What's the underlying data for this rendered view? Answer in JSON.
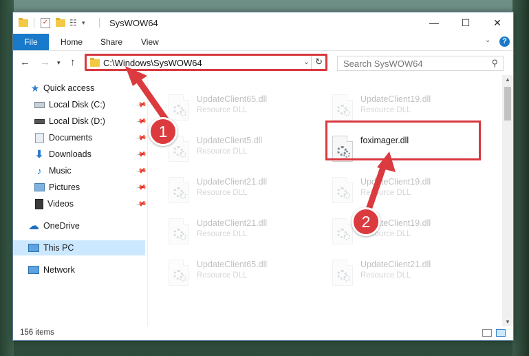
{
  "window": {
    "title": "SysWOW64",
    "controls": {
      "minimize": "—",
      "maximize": "☐",
      "close": "✕"
    }
  },
  "ribbon": {
    "file": "File",
    "tabs": [
      "Home",
      "Share",
      "View"
    ],
    "help": "?"
  },
  "address": {
    "path": "C:\\Windows\\SysWOW64"
  },
  "search": {
    "placeholder": "Search SysWOW64"
  },
  "sidebar": {
    "items": [
      {
        "label": "Quick access",
        "icon": "star-icon",
        "pinned": false
      },
      {
        "label": "Local Disk (C:)",
        "icon": "drive-icon",
        "pinned": true
      },
      {
        "label": "Local Disk (D:)",
        "icon": "drive-icon",
        "pinned": true
      },
      {
        "label": "Documents",
        "icon": "documents-icon",
        "pinned": true
      },
      {
        "label": "Downloads",
        "icon": "download-icon",
        "pinned": true
      },
      {
        "label": "Music",
        "icon": "music-icon",
        "pinned": true
      },
      {
        "label": "Pictures",
        "icon": "pictures-icon",
        "pinned": true
      },
      {
        "label": "Videos",
        "icon": "video-icon",
        "pinned": true
      },
      {
        "label": "OneDrive",
        "icon": "cloud-icon",
        "pinned": false
      },
      {
        "label": "This PC",
        "icon": "computer-icon",
        "pinned": false,
        "selected": true
      },
      {
        "label": "Network",
        "icon": "network-icon",
        "pinned": false
      }
    ]
  },
  "files": [
    {
      "name": "UpdateClient65.dll",
      "type": "Resource DLL",
      "faded": true
    },
    {
      "name": "UpdateClient19.dll",
      "type": "Resource DLL",
      "faded": true
    },
    {
      "name": "UpdateClient5.dll",
      "type": "Resource DLL",
      "faded": true
    },
    {
      "name": "foximager.dll",
      "type": "",
      "faded": false,
      "highlighted": true
    },
    {
      "name": "UpdateClient21.dll",
      "type": "Resource DLL",
      "faded": true
    },
    {
      "name": "UpdateClient19.dll",
      "type": "Resource DLL",
      "faded": true
    },
    {
      "name": "UpdateClient21.dll",
      "type": "Resource DLL",
      "faded": true
    },
    {
      "name": "UpdateClient19.dll",
      "type": "Resource DLL",
      "faded": true
    },
    {
      "name": "UpdateClient65.dll",
      "type": "Resource DLL",
      "faded": true
    },
    {
      "name": "UpdateClient21.dll",
      "type": "Resource DLL",
      "faded": true
    }
  ],
  "status": {
    "item_count": "156 items"
  },
  "annotations": {
    "step1": "1",
    "step2": "2",
    "color": "#db3a3f"
  }
}
